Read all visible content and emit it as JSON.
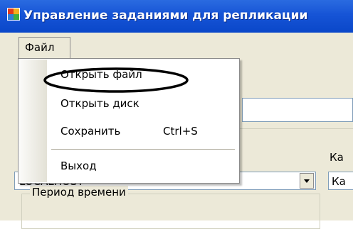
{
  "window": {
    "title": "Управление заданиями для репликации"
  },
  "menubar": {
    "file_label": "Файл"
  },
  "file_menu": {
    "items": [
      {
        "label": "Открыть файл",
        "shortcut": ""
      },
      {
        "label": "Открыть диск",
        "shortcut": ""
      },
      {
        "label": "Сохранить",
        "shortcut": "Ctrl+S"
      },
      {
        "label": "Выход",
        "shortcut": ""
      }
    ],
    "highlighted_item": "Открыть файл"
  },
  "form": {
    "right_label": "Ка",
    "server_value": "LOCALHOST",
    "right_combo_value": "Ка",
    "period_group_label": "Период времени"
  },
  "colors": {
    "titlebar": "#0a47c9",
    "window_bg": "#ece9d8",
    "menu_bg": "#ffffff"
  }
}
